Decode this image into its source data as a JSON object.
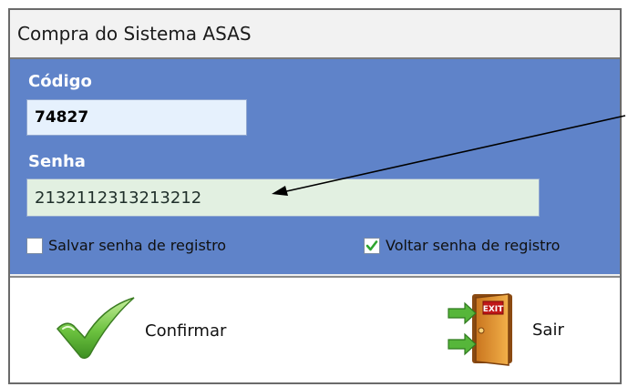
{
  "window": {
    "title": "Compra do Sistema ASAS"
  },
  "form": {
    "codigo_label": "Código",
    "codigo_value": "74827",
    "senha_label": "Senha",
    "senha_value": "2132112313213212"
  },
  "options": {
    "salvar_label": "Salvar senha de registro",
    "salvar_checked": false,
    "voltar_label": "Voltar senha de registro",
    "voltar_checked": true
  },
  "buttons": {
    "confirmar_label": "Confirmar",
    "confirmar_icon": "checkmark-icon",
    "sair_label": "Sair",
    "sair_icon": "exit-door-icon",
    "exit_sign_text": "EXIT"
  },
  "colors": {
    "panel": "#5f83c9",
    "codigo_field": "#e6f1fd",
    "senha_field": "#e2f0e1",
    "check_green": "#2fa52f"
  }
}
